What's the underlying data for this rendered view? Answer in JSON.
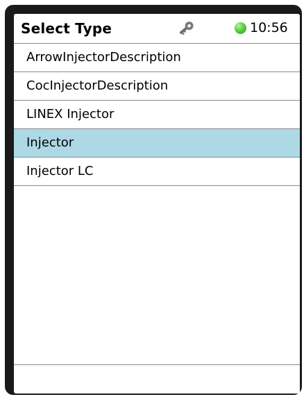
{
  "header": {
    "title": "Select Type",
    "key_icon": "key-icon",
    "status_color": "#4ccf3a",
    "time": "10:56"
  },
  "list": {
    "selected_index": 3,
    "selected_color": "#add8e6",
    "items": [
      {
        "label": "ArrowInjectorDescription"
      },
      {
        "label": "CocInjectorDescription"
      },
      {
        "label": "LINEX Injector"
      },
      {
        "label": "Injector"
      },
      {
        "label": "Injector LC"
      }
    ]
  }
}
